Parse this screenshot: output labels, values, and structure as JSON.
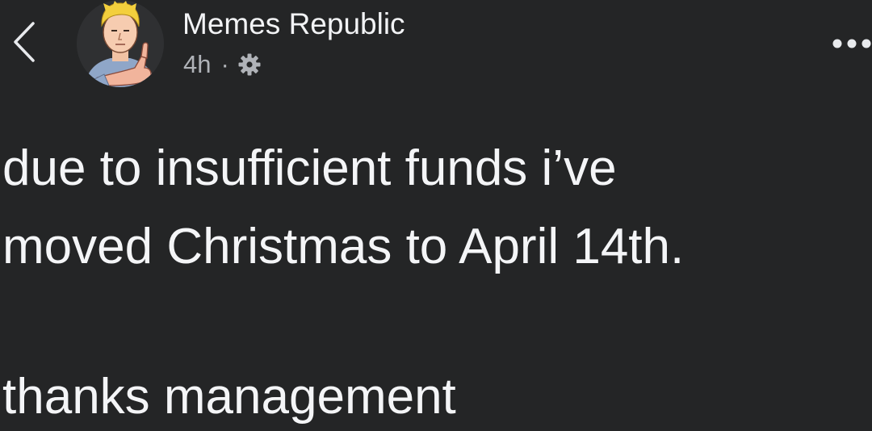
{
  "header": {
    "page_name": "Memes Republic",
    "time_ago": "4h",
    "separator": "·",
    "audience_icon": "gear-icon",
    "back_icon": "chevron-left-icon",
    "more_icon": "more-horizontal-icon",
    "avatar_icon": "avatar-thumbs-up-guy"
  },
  "post": {
    "lines": [
      "due to insufficient funds i’ve",
      "moved Christmas to April 14th.",
      "thanks management"
    ]
  },
  "colors": {
    "background": "#242526",
    "primary_text": "#f4f5f7",
    "secondary_text": "#b0b3b8"
  }
}
